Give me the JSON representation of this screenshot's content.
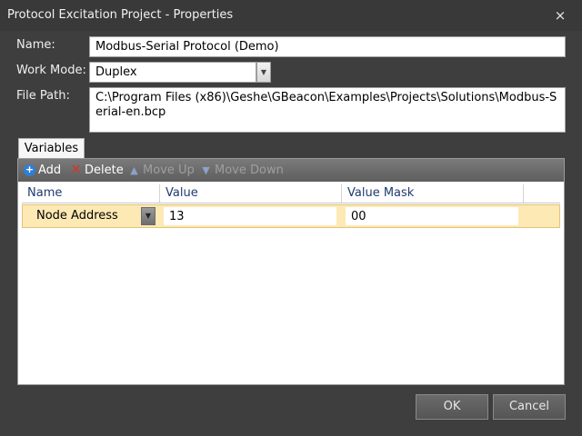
{
  "window": {
    "title": "Protocol Excitation Project - Properties",
    "close_icon": "×"
  },
  "form": {
    "name_label": "Name:",
    "name_value": "Modbus-Serial Protocol (Demo)",
    "work_mode_label": "Work Mode:",
    "work_mode_value": "Duplex",
    "file_path_label": "File Path:",
    "file_path_value": "C:\\Program Files (x86)\\Geshe\\GBeacon\\Examples\\Projects\\Solutions\\Modbus-Serial-en.bcp"
  },
  "tabs": [
    {
      "label": "Variables",
      "active": true
    }
  ],
  "toolbar": {
    "add_label": "Add",
    "delete_label": "Delete",
    "move_up_label": "Move Up",
    "move_down_label": "Move Down"
  },
  "grid": {
    "columns": [
      "Name",
      "Value",
      "Value Mask"
    ],
    "rows": [
      {
        "name": "Node Address",
        "value": "13",
        "value_mask": "00"
      }
    ]
  },
  "buttons": {
    "ok_label": "OK",
    "cancel_label": "Cancel"
  },
  "colors": {
    "selected_row": "#fde9b4",
    "header_text": "#1f3a6e",
    "window_bg": "#3e3e3e"
  }
}
